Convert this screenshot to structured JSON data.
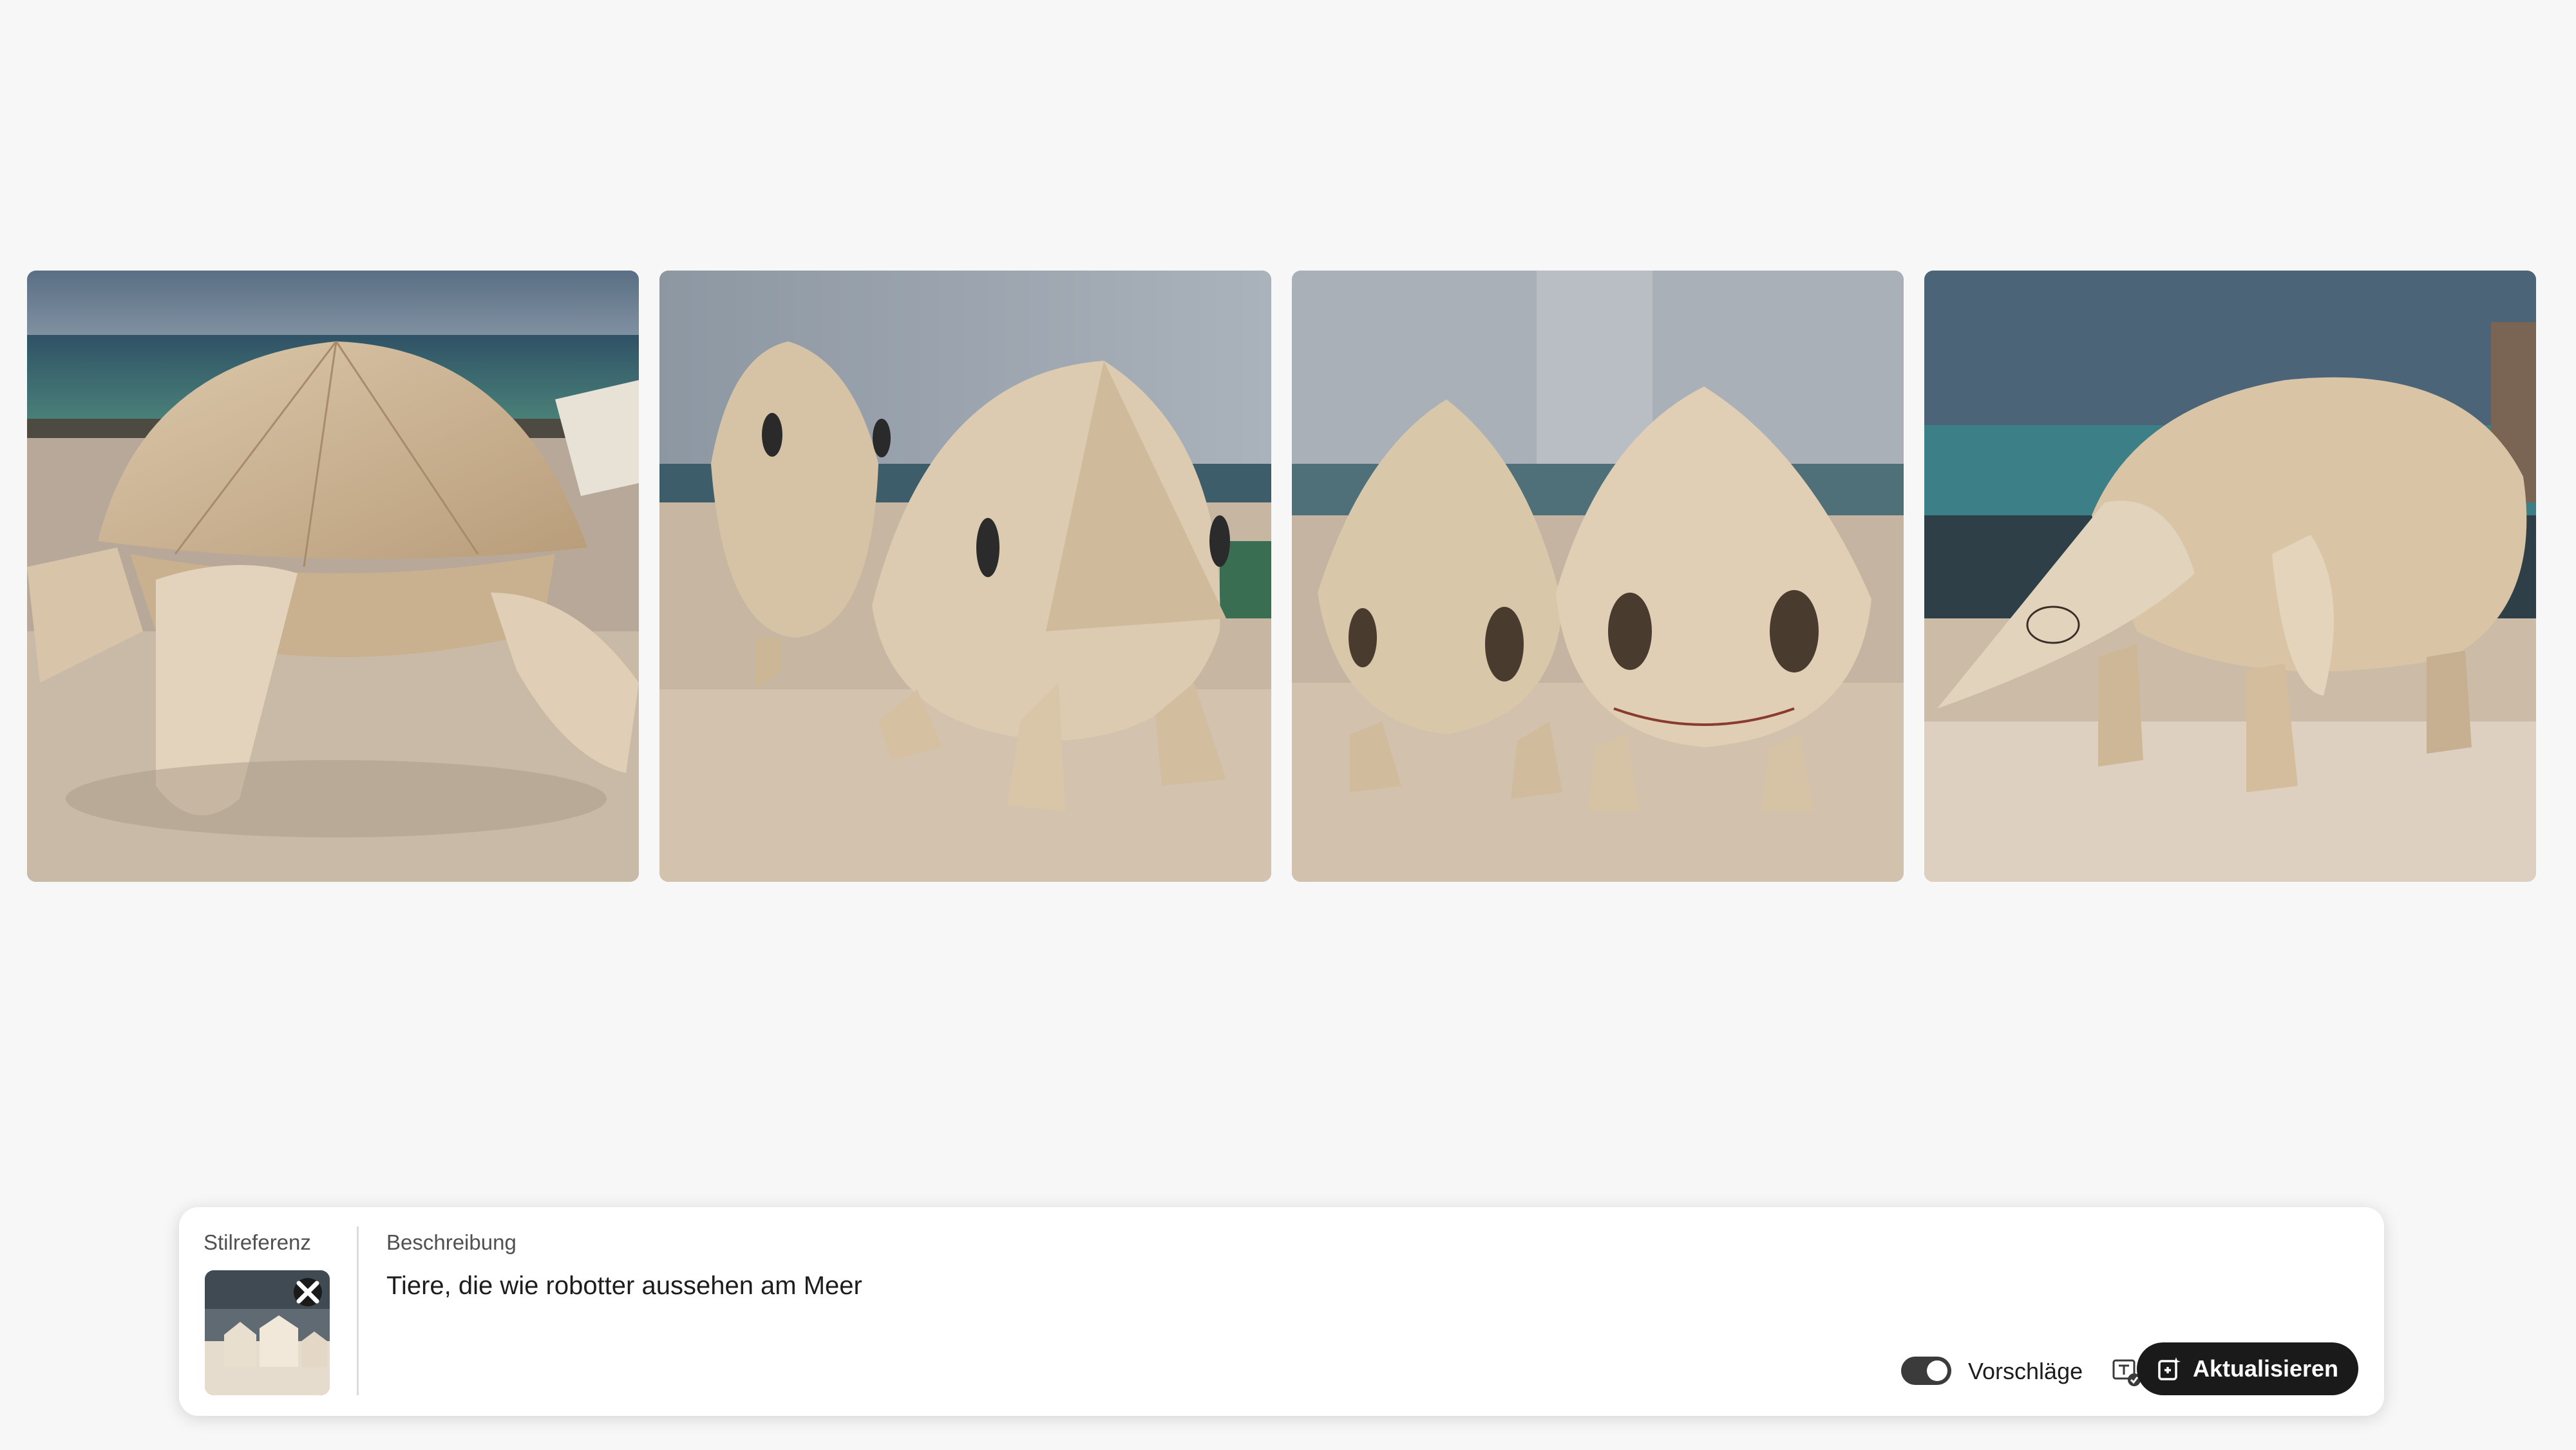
{
  "gallery": {
    "images": [
      {
        "subject": "cardboard turtle-like robot at the sea"
      },
      {
        "subject": "two cardboard bird-like robots at the sea"
      },
      {
        "subject": "two cardboard drop-shaped robots with eyes"
      },
      {
        "subject": "cardboard anteater-like robot at the sea"
      }
    ]
  },
  "prompt_panel": {
    "style_reference_label": "Stilreferenz",
    "description_label": "Beschreibung",
    "description_text": "Tiere, die wie robotter aussehen am Meer",
    "suggestions_label": "Vorschläge",
    "suggestions_enabled": true,
    "update_button_label": "Aktualisieren",
    "close_icon": "close-icon",
    "suggestions_icon": "text-check-icon",
    "update_icon": "generate-icon"
  },
  "colors": {
    "background": "#f7f7f7",
    "panel": "#ffffff",
    "button": "#1a1a1a",
    "cardboard": "#d2bfa3"
  }
}
